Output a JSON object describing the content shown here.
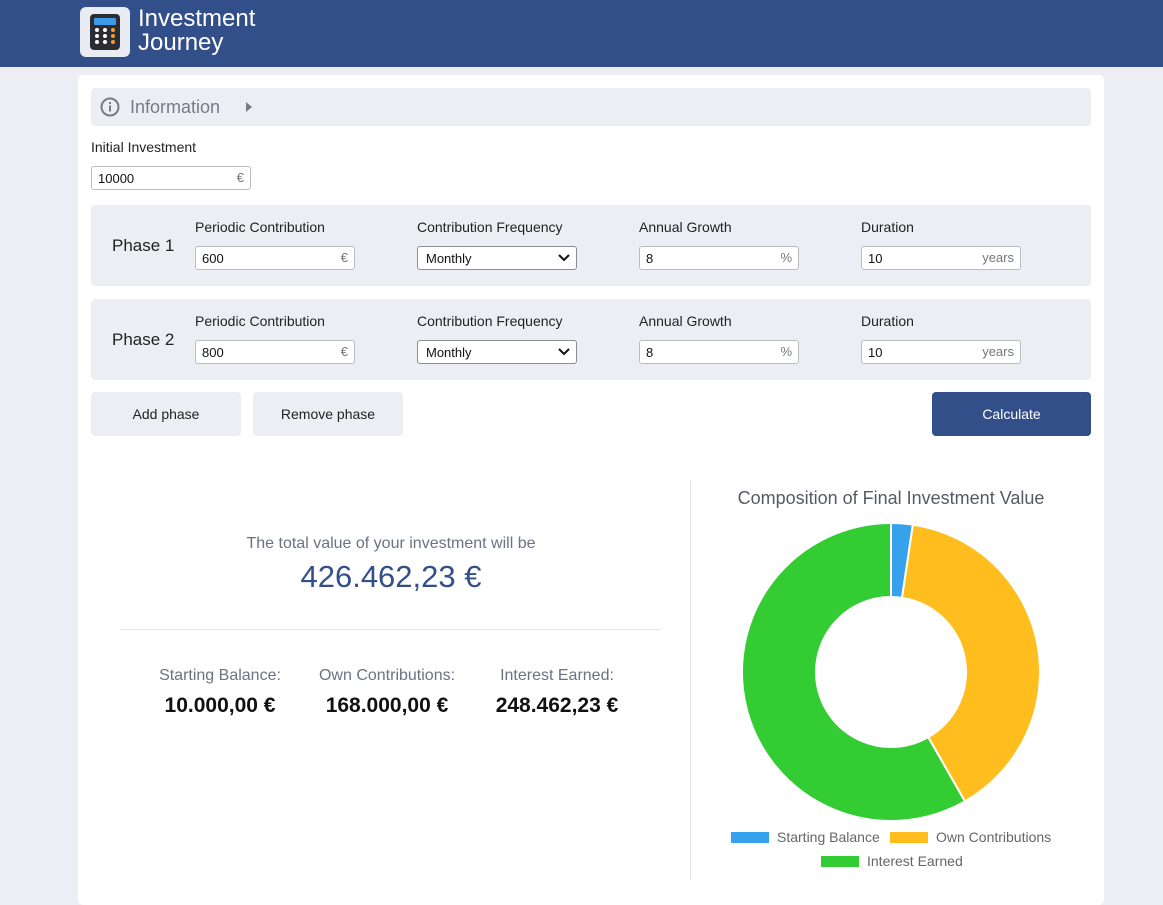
{
  "app": {
    "brand_line1": "Investment",
    "brand_line2": "Journey",
    "logo_icon": "calculator-icon"
  },
  "info": {
    "label": "Information",
    "icon": "info-circle-icon"
  },
  "initial_investment": {
    "label": "Initial Investment",
    "value": "10000",
    "unit": "€"
  },
  "phases": [
    {
      "title": "Phase 1",
      "contribution_label": "Periodic Contribution",
      "contribution_value": "600",
      "contribution_unit": "€",
      "frequency_label": "Contribution Frequency",
      "frequency_value": "Monthly",
      "growth_label": "Annual Growth",
      "growth_value": "8",
      "growth_unit": "%",
      "duration_label": "Duration",
      "duration_value": "10",
      "duration_unit": "years"
    },
    {
      "title": "Phase 2",
      "contribution_label": "Periodic Contribution",
      "contribution_value": "800",
      "contribution_unit": "€",
      "frequency_label": "Contribution Frequency",
      "frequency_value": "Monthly",
      "growth_label": "Annual Growth",
      "growth_value": "8",
      "growth_unit": "%",
      "duration_label": "Duration",
      "duration_value": "10",
      "duration_unit": "years"
    }
  ],
  "buttons": {
    "add_phase": "Add phase",
    "remove_phase": "Remove phase",
    "calculate": "Calculate"
  },
  "results": {
    "lead": "The total value of your investment will be",
    "total": "426.462,23 €",
    "starting_label": "Starting Balance:",
    "starting_value": "10.000,00 €",
    "contrib_label": "Own Contributions:",
    "contrib_value": "168.000,00 €",
    "interest_label": "Interest Earned:",
    "interest_value": "248.462,23 €"
  },
  "colors": {
    "header": "#334f8a",
    "starting": "#36a2eb",
    "contributions": "#ffbe1e",
    "interest": "#33cc33"
  },
  "chart_data": {
    "type": "pie",
    "title": "Composition of Final Investment Value",
    "categories": [
      "Starting Balance",
      "Own Contributions",
      "Interest Earned"
    ],
    "values": [
      10000.0,
      168000.0,
      248462.23
    ],
    "colors": [
      "#36a2eb",
      "#ffbe1e",
      "#33cc33"
    ],
    "style": "doughnut",
    "legend": "bottom"
  }
}
